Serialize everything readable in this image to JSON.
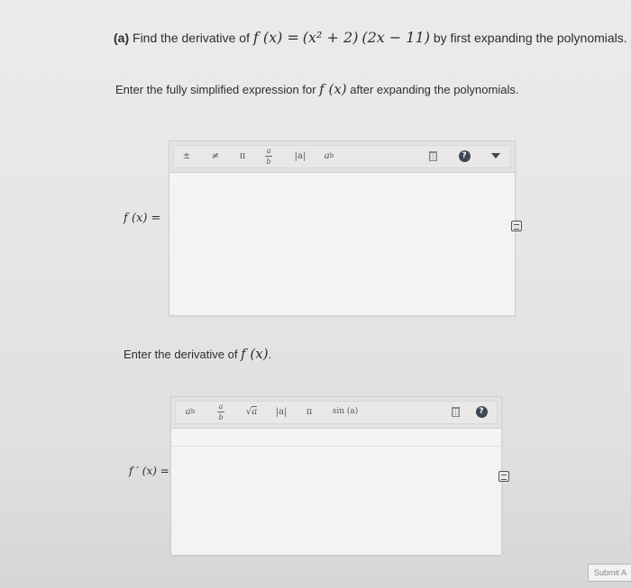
{
  "question": {
    "part_label": "(a)",
    "text_before": "Find the derivative of",
    "fn_lhs": "f (x) =",
    "expr_1": "(x² + 2)",
    "expr_2": "(2x − 11)",
    "text_after": "by first expanding the polynomials."
  },
  "instruction_1": {
    "text_before": "Enter the fully simplified expression for",
    "fn": "f (x)",
    "text_after": "after expanding the polynomials."
  },
  "editor_1": {
    "label": "f (x) =",
    "toolbar": [
      "±",
      "≠",
      "π",
      "a/b",
      "|a|",
      "a^b"
    ],
    "frac_num": "a",
    "frac_den": "b",
    "value": ""
  },
  "instruction_2": {
    "text_before": "Enter the derivative of",
    "fn": "f (x)",
    "text_after": "."
  },
  "editor_2": {
    "label": "f ′ (x) =",
    "toolbar": [
      "a^b",
      "a/b",
      "√a",
      "|a|",
      "π",
      "sin (a)"
    ],
    "sqrt_arg": "a",
    "value": ""
  },
  "help_glyph": "?",
  "submit_label": "Submit A"
}
